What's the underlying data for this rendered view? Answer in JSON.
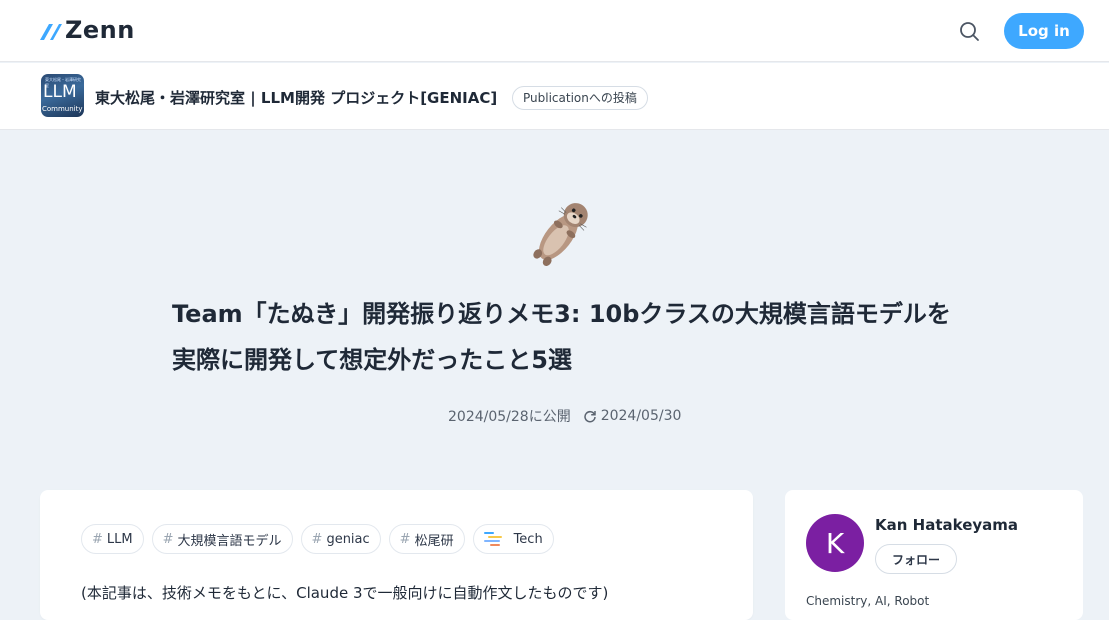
{
  "header": {
    "logo_text": "Zenn",
    "login_label": "Log in"
  },
  "publication": {
    "avatar_big": "LLM",
    "avatar_small": "Community",
    "avatar_tiny": "東大松尾・岩澤研究室",
    "name": "東大松尾・岩澤研究室 | LLM開発 プロジェクト[GENIAC]",
    "badge": "Publicationへの投稿"
  },
  "article": {
    "title": "Team「たぬき」開発振り返りメモ3: 10bクラスの大規模言語モデルを実際に開発して想定外だったこと5選",
    "published": "2024/05/28に公開",
    "updated": "2024/05/30",
    "tags": [
      {
        "label": "LLM"
      },
      {
        "label": "大規模言語モデル"
      },
      {
        "label": "geniac"
      },
      {
        "label": "松尾研"
      }
    ],
    "topic_type": "Tech",
    "intro": "(本記事は、技術メモをもとに、Claude 3で一般向けに自動作文したものです)"
  },
  "author": {
    "avatar_letter": "K",
    "name": "Kan Hatakeyama",
    "follow_label": "フォロー",
    "bio": "Chemistry, AI, Robot"
  },
  "colors": {
    "accent": "#3ea8ff",
    "background": "#edf2f7",
    "author_avatar": "#7b1fa2"
  }
}
